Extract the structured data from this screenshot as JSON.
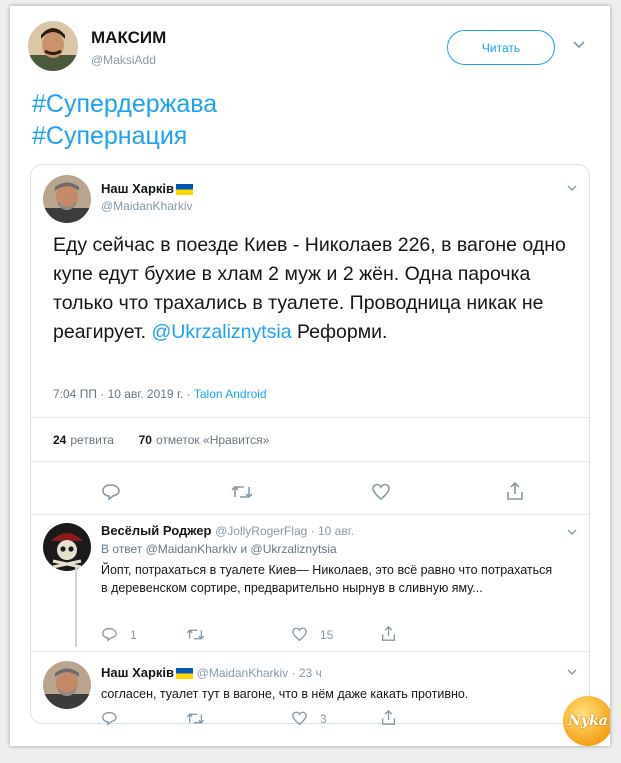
{
  "tweet": {
    "author_name": "МАКСИМ",
    "author_handle": "@MaksiAdd",
    "follow_label": "Читать",
    "hashtags": [
      "#Супердержава",
      "#Супернация"
    ]
  },
  "quoted": {
    "author_name": "Наш Харків",
    "author_handle": "@MaidanKharkiv",
    "text": "Еду сейчас в поезде Киев - Николаев 226, в вагоне одно купе едут бухие в хлам 2 муж и 2 жён. Одна парочка только что трахались в туалете. Проводница никак не реагирует.",
    "mention": "@Ukrzaliznytsia",
    "text_end": "Реформи.",
    "time": "7:04 ПП · 10 авг. 2019 г. · ",
    "source": "Talon Android",
    "retweets_count": "24",
    "retweets_label": "ретвита",
    "likes_count": "70",
    "likes_label": "отметок «Нравится»"
  },
  "replies": [
    {
      "name": "Весёлый Роджер",
      "handle": "@JollyRogerFlag · 10 авг.",
      "reply_to": "В ответ @MaidanKharkiv и @Ukrzaliznytsia",
      "text": "Йопт, потрахаться в туалете Киев— Николаев, это всё равно что потрахаться в деревенском сортире, предварительно нырнув в сливную яму...",
      "replies_count": "1",
      "likes_count": "15"
    },
    {
      "name": "Наш Харків",
      "handle": "@MaidanKharkiv · 23 ч",
      "text": "согласен, туалет тут в вагоне, что в нём даже какать противно.",
      "likes_count": "3"
    }
  ],
  "watermark": "Nyka",
  "colors": {
    "accent": "#1da1f2",
    "muted": "#8899a6"
  }
}
